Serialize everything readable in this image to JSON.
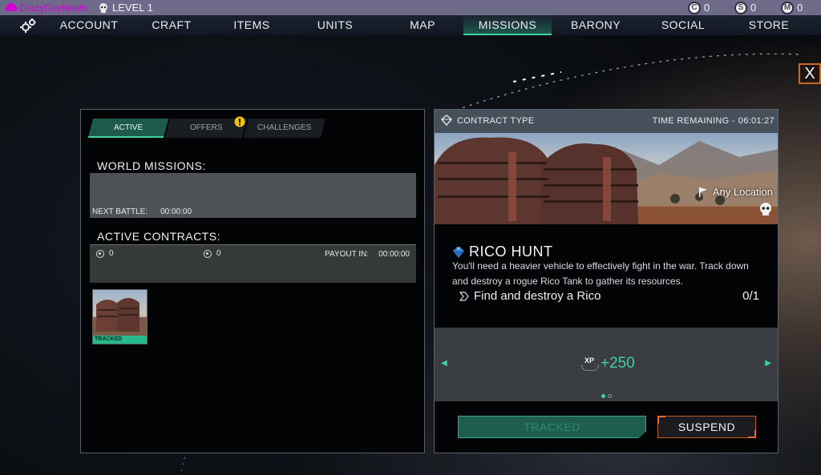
{
  "statusbar": {
    "username": "CrazyGuyNewb",
    "level": "LEVEL 1",
    "currencies": [
      {
        "icon": "C",
        "value": "0"
      },
      {
        "icon": "S",
        "value": "0"
      },
      {
        "icon": "M",
        "value": "0"
      }
    ]
  },
  "nav": {
    "items": [
      "ACCOUNT",
      "CRAFT",
      "ITEMS",
      "UNITS",
      "MAP",
      "MISSIONS",
      "BARONY",
      "SOCIAL",
      "STORE"
    ],
    "active": "MISSIONS"
  },
  "close_label": "X",
  "left": {
    "tabs": [
      "ACTIVE",
      "OFFERS",
      "CHALLENGES"
    ],
    "active_tab": "ACTIVE",
    "world_missions_title": "WORLD MISSIONS:",
    "next_battle_label": "NEXT BATTLE:",
    "next_battle_time": "00:00:00",
    "active_contracts_title": "ACTIVE CONTRACTS:",
    "contract_stat_1": "0",
    "contract_stat_2": "0",
    "payout_label": "PAYOUT IN:",
    "payout_time": "00:00:00",
    "thumb_badge": "TRACKED"
  },
  "right": {
    "contract_type_label": "CONTRACT TYPE",
    "time_remaining_label": "TIME REMAINING  -",
    "time_remaining": "06:01:27",
    "location": "Any Location",
    "mission_title": "RICO HUNT",
    "mission_desc": "You'll need a heavier vehicle to effectively fight in the war. Track down and destroy a rogue Rico Tank to gather its resources.",
    "objective": "Find and destroy a Rico",
    "objective_progress": "0/1",
    "reward_badge": "XP",
    "reward_value": "+250",
    "tracked_button": "TRACKED",
    "suspend_button": "SUSPEND"
  },
  "colors": {
    "accent": "#3fd0a4",
    "warning": "#e56a2a",
    "username": "#d400d4",
    "statusbar": "#6d6a8a"
  }
}
